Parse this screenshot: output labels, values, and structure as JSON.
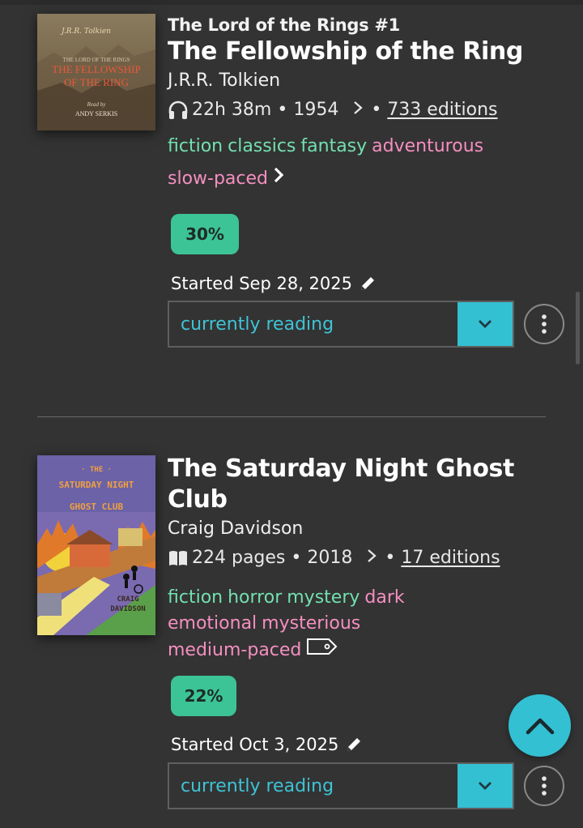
{
  "books": [
    {
      "series": "The Lord of the Rings #1",
      "title": "The Fellowship of the Ring",
      "author": "J.R.R. Tolkien",
      "format_icon": "headphones-icon",
      "length": "22h 38m",
      "year": "1954",
      "editions": "733 editions",
      "genres": [
        "fiction",
        "classics",
        "fantasy"
      ],
      "moods": [
        "adventurous"
      ],
      "pace": "slow-paced",
      "progress": "30%",
      "started": "Started Sep 28, 2025",
      "status": "currently reading",
      "cover": {
        "author_sig": "J.R.R. Tolkien",
        "line1": "THE LORD OF THE RINGS",
        "line2": "THE FELLOWSHIP",
        "line3": "OF THE RING",
        "read_by": "Read by",
        "narrator": "ANDY SERKIS"
      }
    },
    {
      "series": "",
      "title": "The Saturday Night Ghost Club",
      "author": "Craig Davidson",
      "format_icon": "book-open-icon",
      "length": "224 pages",
      "year": "2018",
      "editions": "17 editions",
      "genres": [
        "fiction",
        "horror",
        "mystery"
      ],
      "moods": [
        "dark",
        "emotional",
        "mysterious"
      ],
      "pace": "medium-paced",
      "progress": "22%",
      "started": "Started Oct 3, 2025",
      "status": "currently reading",
      "cover": {
        "the": "· THE ·",
        "line1": "SATURDAY NIGHT",
        "line2": "GHOST CLUB",
        "author1": "CRAIG",
        "author2": "DAVIDSON"
      }
    }
  ],
  "colors": {
    "background": "#333333",
    "accent": "#33c0d3",
    "progress": "#3cc496",
    "genre_tag": "#72e0b0",
    "mood_tag": "#f48fc0"
  }
}
